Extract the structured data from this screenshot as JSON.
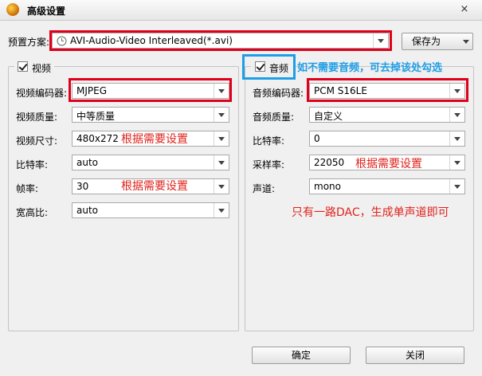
{
  "window": {
    "title": "高级设置",
    "close_glyph": "×"
  },
  "preset": {
    "label": "预置方案:",
    "value": "AVI-Audio-Video Interleaved(*.avi)",
    "save_as": "保存为"
  },
  "video": {
    "title": "视频",
    "codec_label": "视频编码器:",
    "codec_value": "MJPEG",
    "quality_label": "视频质量:",
    "quality_value": "中等质量",
    "size_label": "视频尺寸:",
    "size_value": "480x272",
    "bitrate_label": "比特率:",
    "bitrate_value": "auto",
    "framerate_label": "帧率:",
    "framerate_value": "30",
    "aspect_label": "宽高比:",
    "aspect_value": "auto"
  },
  "audio": {
    "title": "音频",
    "codec_label": "音频编码器:",
    "codec_value": "PCM S16LE",
    "quality_label": "音频质量:",
    "quality_value": "自定义",
    "bitrate_label": "比特率:",
    "bitrate_value": "0",
    "samplerate_label": "采样率:",
    "samplerate_value": "22050",
    "channel_label": "声道:",
    "channel_value": "mono"
  },
  "annotations": {
    "set_as_needed_1": "根据需要设置",
    "set_as_needed_2": "根据需要设置",
    "set_as_needed_3": "根据需要设置",
    "audio_tip": "如不需要音频，可去掉该处勾选",
    "mono_tip": "只有一路DAC，生成单声道即可"
  },
  "buttons": {
    "ok": "确定",
    "close": "关闭"
  },
  "colors": {
    "annotation_red": "#e0221b",
    "annotation_blue": "#1e9ee6"
  }
}
